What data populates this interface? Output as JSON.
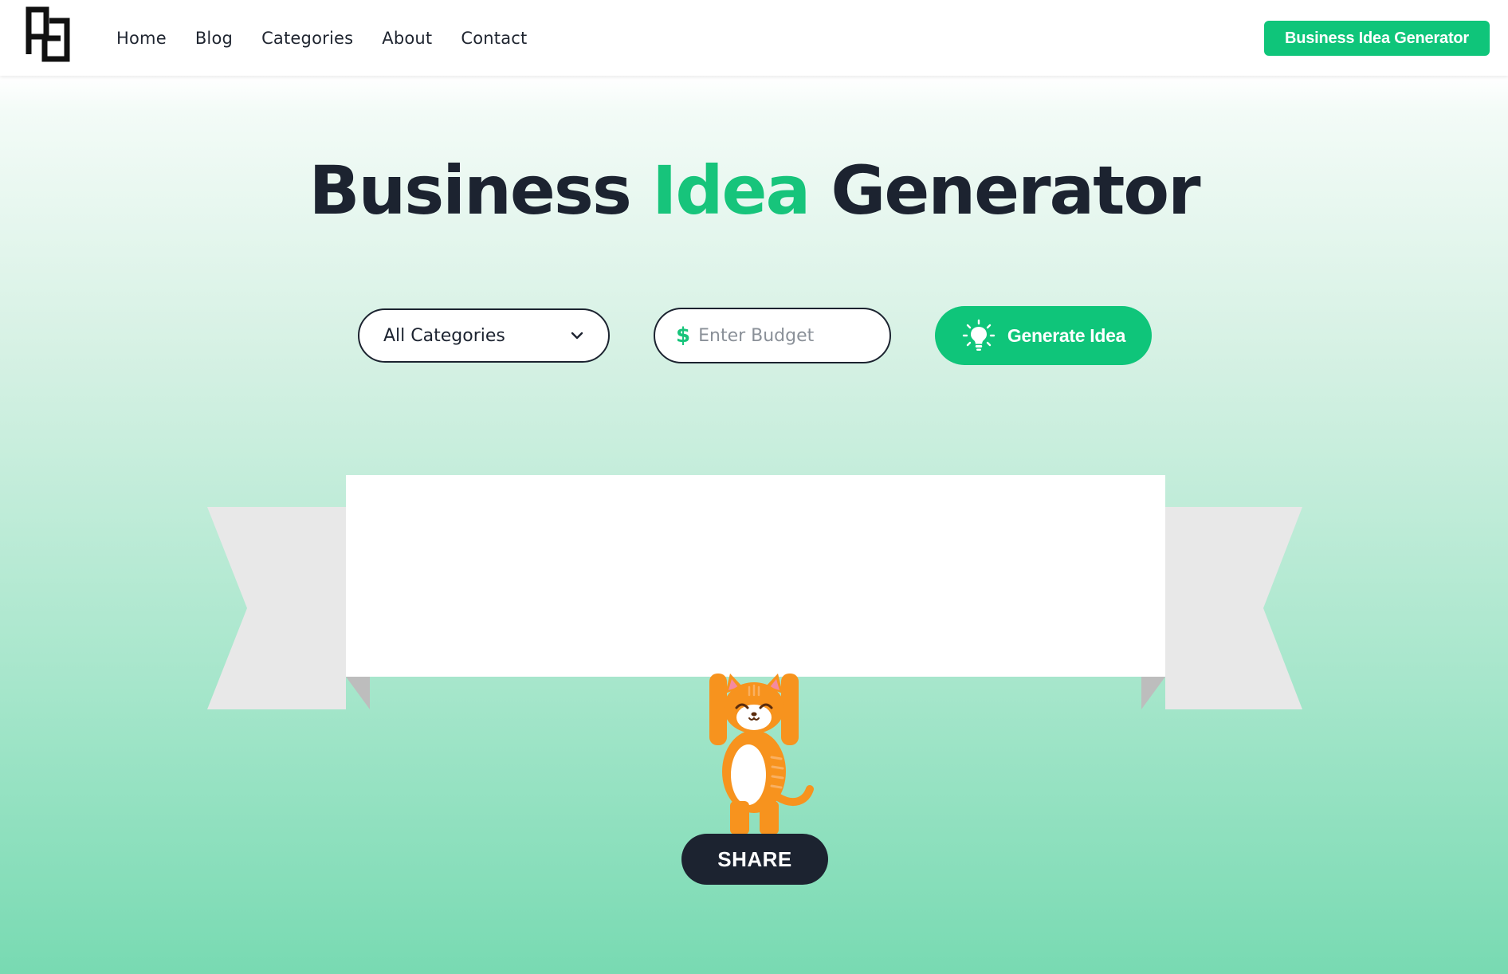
{
  "nav": {
    "logo_icon": "pd-monogram-logo",
    "items": [
      {
        "label": "Home"
      },
      {
        "label": "Blog"
      },
      {
        "label": "Categories"
      },
      {
        "label": "About"
      },
      {
        "label": "Contact"
      }
    ],
    "cta_label": "Business Idea Generator"
  },
  "hero": {
    "title_part1": "Business",
    "title_accent": "Idea",
    "title_part2": "Generator"
  },
  "controls": {
    "category_select": {
      "value": "All Categories",
      "icon": "chevron-down-icon"
    },
    "budget": {
      "currency_symbol": "$",
      "placeholder": "Enter Budget",
      "value": ""
    },
    "generate_button": {
      "label": "Generate Idea",
      "icon": "lightbulb-icon"
    }
  },
  "result": {
    "idea_text": ""
  },
  "share": {
    "label": "SHARE"
  },
  "colors": {
    "accent": "#0fc57a",
    "dark": "#1c2330",
    "ribbon_fold": "#e8e8e8",
    "ribbon_shadow": "#bdbdbd",
    "cat_orange": "#f7931e"
  }
}
